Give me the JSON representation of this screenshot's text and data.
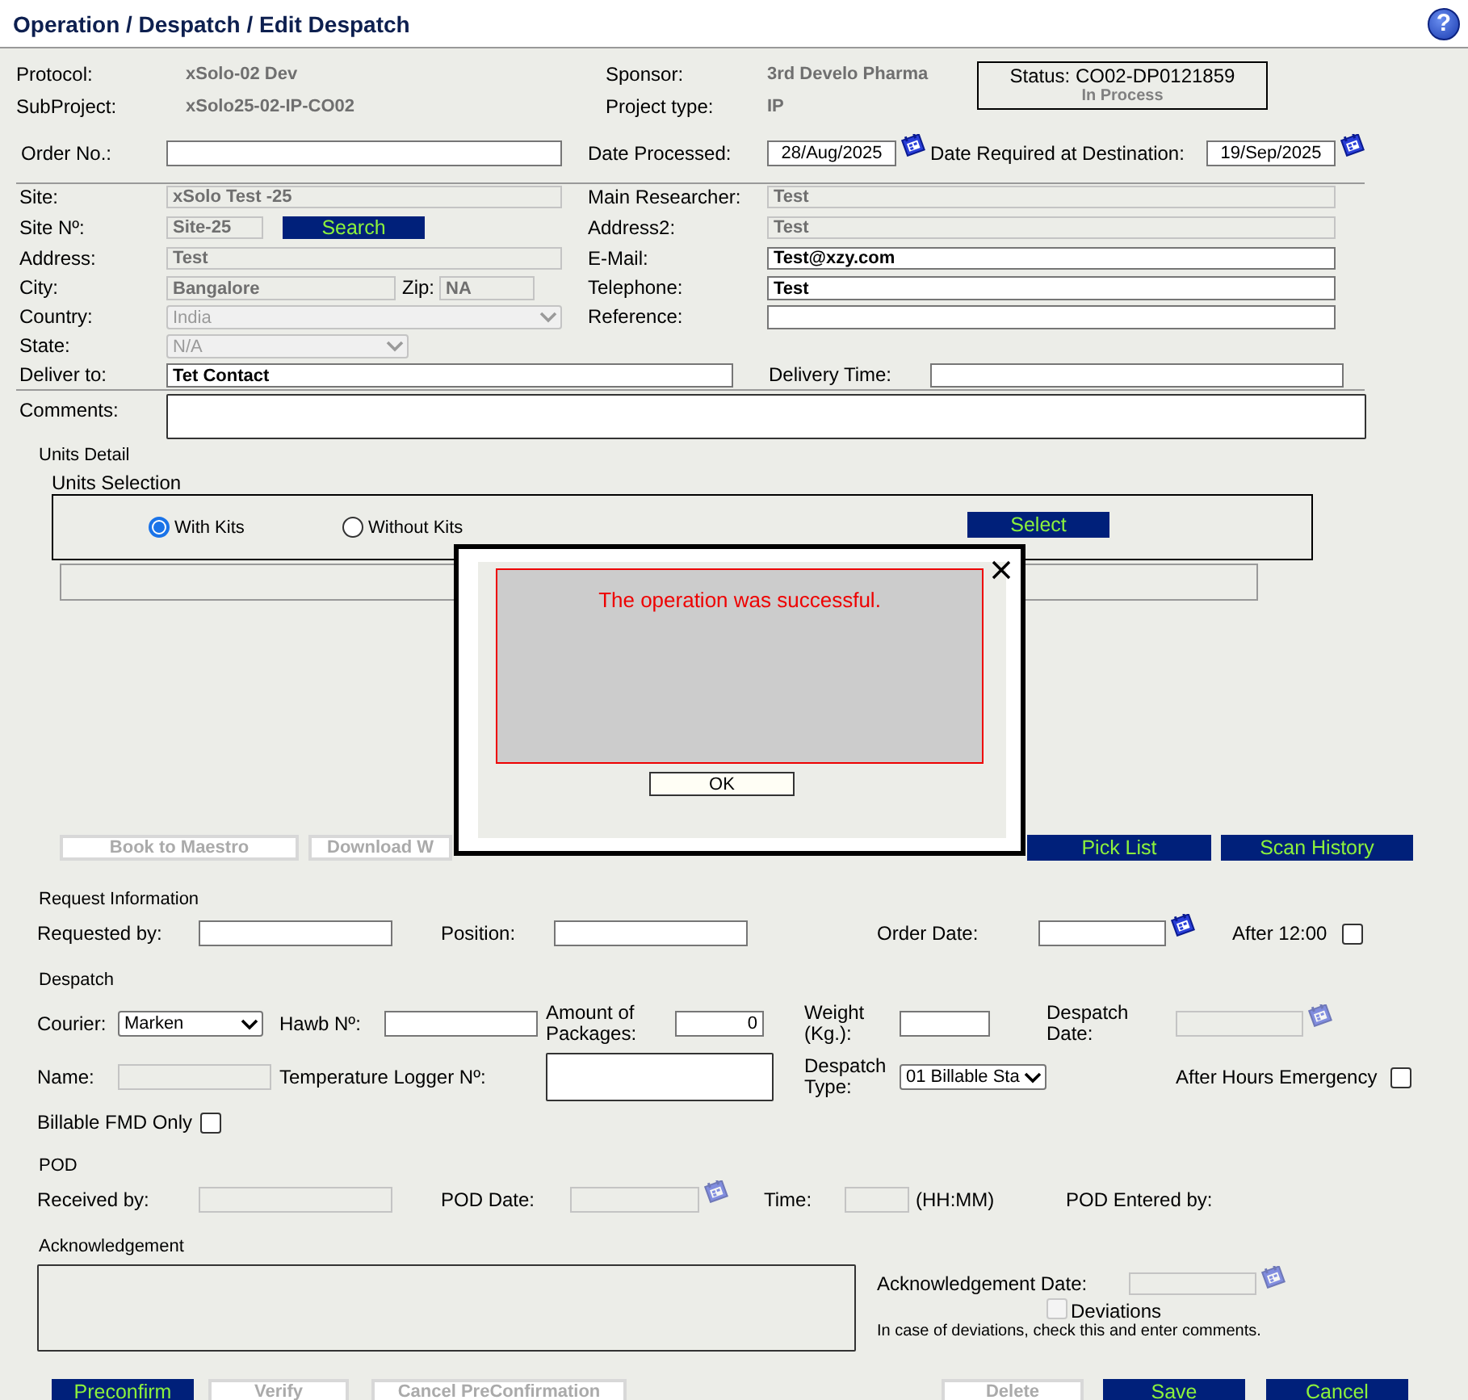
{
  "header": {
    "title": "Operation / Despatch / Edit Despatch",
    "help": "?"
  },
  "summary": [
    {
      "label": "Protocol:",
      "value": "xSolo-02 Dev"
    },
    {
      "label": "Sponsor:",
      "value": "3rd Develo Pharma"
    },
    {
      "label": "SubProject:",
      "value": "xSolo25-02-IP-CO02"
    },
    {
      "label": "Project type:",
      "value": "IP"
    }
  ],
  "status": {
    "code": "Status: CO02-DP0121859",
    "state": "In Process"
  },
  "top_rows": [
    [
      {
        "kind": "label",
        "text": "Order No.:"
      },
      {
        "kind": "input",
        "disabled": false
      },
      {
        "kind": "label",
        "text": "Date Processed:"
      },
      {
        "kind": "date",
        "value": "28/Aug/2025",
        "disabled": false
      },
      {
        "kind": "label",
        "text": "Date Required at Destination:"
      },
      {
        "kind": "date",
        "value": "19/Sep/2025",
        "disabled": false
      }
    ],
    [
      {
        "kind": "label",
        "text": "Site:"
      },
      {
        "kind": "input",
        "value": "xSolo Test -25",
        "disabled": true
      },
      {
        "kind": "label",
        "text": "Main Researcher:"
      },
      {
        "kind": "input",
        "value": "Test",
        "disabled": true
      }
    ],
    [
      {
        "kind": "label",
        "text": "Site Nº:"
      },
      {
        "kind": "input",
        "value": "Site-25",
        "disabled": true
      },
      {
        "kind": "button",
        "text": "Search",
        "disabled": false
      },
      {
        "kind": "label",
        "text": "Address2:"
      },
      {
        "kind": "input",
        "value": "Test",
        "disabled": true
      }
    ],
    [
      {
        "kind": "label",
        "text": "Address:"
      },
      {
        "kind": "input",
        "value": "Test",
        "disabled": true
      },
      {
        "kind": "label",
        "text": "E-Mail:"
      },
      {
        "kind": "input",
        "value": "Test@xzy.com",
        "disabled": false
      }
    ],
    [
      {
        "kind": "label",
        "text": "City:"
      },
      {
        "kind": "input",
        "value": "Bangalore",
        "disabled": true
      },
      {
        "kind": "label",
        "text": "Zip:"
      },
      {
        "kind": "input",
        "value": "NA",
        "disabled": true
      },
      {
        "kind": "label",
        "text": "Telephone:"
      },
      {
        "kind": "input",
        "value": "Test",
        "disabled": false
      }
    ],
    [
      {
        "kind": "label",
        "text": "Country:"
      },
      {
        "kind": "select",
        "value": "India",
        "disabled": true
      },
      {
        "kind": "label",
        "text": "Reference:"
      },
      {
        "kind": "input",
        "disabled": false
      }
    ],
    [
      {
        "kind": "label",
        "text": "State:"
      },
      {
        "kind": "select",
        "value": "N/A",
        "disabled": true
      }
    ],
    [
      {
        "kind": "label",
        "text": "Deliver to:"
      },
      {
        "kind": "input",
        "value": "Tet Contact",
        "disabled": false
      },
      {
        "kind": "label",
        "text": "Delivery Time:"
      },
      {
        "kind": "input",
        "disabled": false
      }
    ],
    [
      {
        "kind": "label",
        "text": "Comments:"
      },
      {
        "kind": "textarea",
        "disabled": false
      }
    ]
  ],
  "units": {
    "detail_title": "Units Detail",
    "selection_title": "Units Selection",
    "options": [
      {
        "label": "With Kits",
        "selected": true
      },
      {
        "label": "Without Kits",
        "selected": false
      }
    ],
    "select_button": {
      "text": "Select",
      "disabled": false
    }
  },
  "actions": [
    {
      "text": "Book to Maestro",
      "disabled": true
    },
    {
      "text": "Download W",
      "disabled": true
    },
    {
      "text": "Pick List",
      "disabled": false
    },
    {
      "text": "Scan History",
      "disabled": false
    }
  ],
  "lower_rows": [
    [
      {
        "kind": "heading",
        "text": "Request Information"
      }
    ],
    [
      {
        "kind": "label",
        "text": "Requested by:"
      },
      {
        "kind": "input",
        "disabled": false
      },
      {
        "kind": "label",
        "text": "Position:"
      },
      {
        "kind": "input",
        "disabled": false
      },
      {
        "kind": "label",
        "text": "Order Date:"
      },
      {
        "kind": "date",
        "disabled": false
      },
      {
        "kind": "label",
        "text": "After 12:00"
      },
      {
        "kind": "checkbox",
        "checked": false,
        "disabled": false
      }
    ],
    [
      {
        "kind": "heading",
        "text": "Despatch"
      }
    ],
    [
      {
        "kind": "label",
        "text": "Courier:"
      },
      {
        "kind": "select",
        "value": "Marken",
        "disabled": false
      },
      {
        "kind": "label",
        "text": "Hawb Nº:"
      },
      {
        "kind": "input",
        "disabled": false
      },
      {
        "kind": "label",
        "text": "Amount of Packages:"
      },
      {
        "kind": "number",
        "value": "0",
        "disabled": false
      },
      {
        "kind": "label",
        "text": "Weight (Kg.):"
      },
      {
        "kind": "input",
        "disabled": false
      },
      {
        "kind": "label",
        "text": "Despatch Date:"
      },
      {
        "kind": "date",
        "disabled": true
      }
    ],
    [
      {
        "kind": "label",
        "text": "Name:"
      },
      {
        "kind": "input",
        "disabled": true
      },
      {
        "kind": "label",
        "text": "Temperature Logger Nº:"
      },
      {
        "kind": "textarea",
        "disabled": false
      },
      {
        "kind": "label",
        "text": "Despatch Type:"
      },
      {
        "kind": "select",
        "value": "01 Billable Sta",
        "disabled": false
      },
      {
        "kind": "label",
        "text": "After Hours Emergency"
      },
      {
        "kind": "checkbox",
        "checked": false,
        "disabled": false
      }
    ],
    [
      {
        "kind": "label",
        "text": "Billable FMD Only"
      },
      {
        "kind": "checkbox",
        "checked": false,
        "disabled": false
      }
    ],
    [
      {
        "kind": "heading",
        "text": "POD"
      }
    ],
    [
      {
        "kind": "label",
        "text": "Received by:"
      },
      {
        "kind": "input",
        "disabled": true
      },
      {
        "kind": "label",
        "text": "POD Date:"
      },
      {
        "kind": "date",
        "disabled": true
      },
      {
        "kind": "label",
        "text": "Time:"
      },
      {
        "kind": "input",
        "disabled": true
      },
      {
        "kind": "label",
        "text": "(HH:MM)"
      },
      {
        "kind": "label",
        "text": "POD Entered by:"
      }
    ],
    [
      {
        "kind": "heading",
        "text": "Acknowledgement"
      }
    ]
  ],
  "acknowledgement": {
    "comments": {
      "disabled": true
    },
    "date_label": "Acknowledgement Date:",
    "date": {
      "disabled": true
    },
    "deviations": {
      "label": "Deviations",
      "checked": false,
      "disabled": true
    },
    "hint": "In case of deviations, check this and enter comments."
  },
  "footer_buttons": [
    {
      "text": "Preconfirm",
      "disabled": false
    },
    {
      "text": "Verify",
      "disabled": true
    },
    {
      "text": "Cancel PreConfirmation",
      "disabled": true
    },
    {
      "text": "Delete",
      "disabled": true
    },
    {
      "text": "Save",
      "disabled": false
    },
    {
      "text": "Cancel",
      "disabled": false
    }
  ],
  "dialog": {
    "message": "The operation was successful.",
    "button": "OK"
  }
}
